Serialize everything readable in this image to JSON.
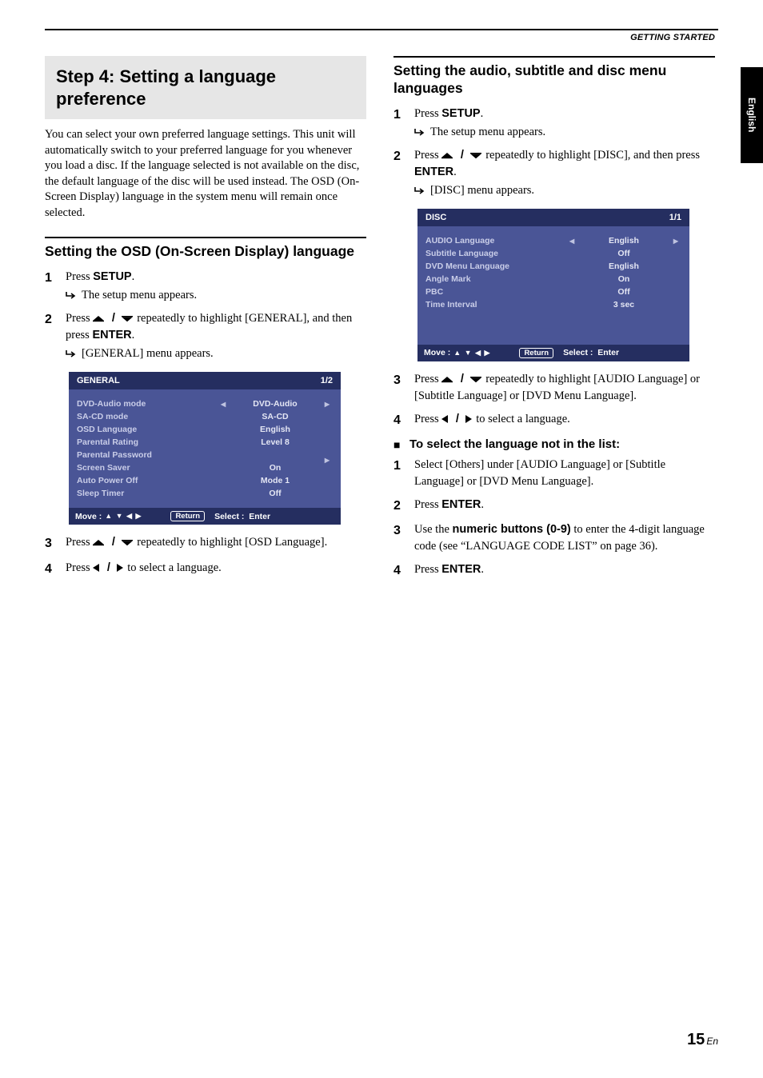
{
  "header_label": "GETTING STARTED",
  "side_tab": "English",
  "left": {
    "step_title": "Step 4: Setting a language preference",
    "intro": "You can select your own preferred language settings. This unit will automatically switch to your preferred language for you whenever you load a disc. If the language selected is not available on the disc, the default language of the disc will be used instead. The OSD (On-Screen Display) language in the system menu will remain once selected.",
    "heading1": "Setting the OSD (On-Screen Display) language",
    "s1": {
      "pre": "Press ",
      "btn": "SETUP",
      "post": ".",
      "sub": "The setup menu appears."
    },
    "s2": {
      "pre": "Press ",
      "mid1": " / ",
      "mid2": " repeatedly to highlight [GENERAL], and then press ",
      "btn": "ENTER",
      "post": ".",
      "sub": "[GENERAL] menu appears."
    },
    "menu": {
      "title": "GENERAL",
      "page": "1/2",
      "rows": [
        {
          "label": "DVD-Audio mode",
          "value": "DVD-Audio",
          "lr": true
        },
        {
          "label": "SA-CD mode",
          "value": "SA-CD"
        },
        {
          "label": "OSD Language",
          "value": "English"
        },
        {
          "label": "Parental Rating",
          "value": "Level 8"
        },
        {
          "label": "Parental Password",
          "value": "",
          "ronly": true
        },
        {
          "label": "Screen Saver",
          "value": "On"
        },
        {
          "label": "Auto Power Off",
          "value": "Mode 1"
        },
        {
          "label": "Sleep Timer",
          "value": "Off"
        }
      ],
      "footer": {
        "move": "Move :",
        "ret": "Return",
        "select": "Select :",
        "enter": "Enter"
      }
    },
    "s3": {
      "pre": "Press ",
      "mid1": " / ",
      "mid2": " repeatedly to highlight [OSD Language]."
    },
    "s4": {
      "pre": "Press ",
      "mid1": " / ",
      "mid2": " to select a language."
    }
  },
  "right": {
    "heading1": "Setting the audio, subtitle and disc menu languages",
    "s1": {
      "pre": "Press ",
      "btn": "SETUP",
      "post": ".",
      "sub": "The setup menu appears."
    },
    "s2": {
      "pre": "Press ",
      "mid1": " / ",
      "mid2": " repeatedly to highlight [DISC], and then press ",
      "btn": "ENTER",
      "post": ".",
      "sub": "[DISC] menu appears."
    },
    "menu": {
      "title": "DISC",
      "page": "1/1",
      "rows": [
        {
          "label": "AUDIO Language",
          "value": "English",
          "lr": true
        },
        {
          "label": "Subtitle Language",
          "value": "Off"
        },
        {
          "label": "DVD Menu Language",
          "value": "English"
        },
        {
          "label": "Angle Mark",
          "value": "On"
        },
        {
          "label": "PBC",
          "value": "Off"
        },
        {
          "label": "Time Interval",
          "value": "3 sec"
        }
      ],
      "footer": {
        "move": "Move :",
        "ret": "Return",
        "select": "Select :",
        "enter": "Enter"
      }
    },
    "s3": {
      "pre": "Press ",
      "mid1": " / ",
      "mid2": " repeatedly to highlight [AUDIO Language] or [Subtitle Language] or [DVD Menu Language]."
    },
    "s4": {
      "pre": "Press ",
      "mid1": " / ",
      "mid2": " to select a language."
    },
    "notinlist_heading": "To select the language not in the list:",
    "n1": "Select [Others] under [AUDIO Language] or [Subtitle Language] or [DVD Menu Language].",
    "n2": {
      "pre": "Press ",
      "btn": "ENTER",
      "post": "."
    },
    "n3": {
      "pre": "Use the ",
      "bold": "numeric buttons (0-9)",
      "post": " to enter the 4-digit language code (see “LANGUAGE CODE LIST” on page 36)."
    },
    "n4": {
      "pre": "Press ",
      "btn": "ENTER",
      "post": "."
    }
  },
  "page_num": "15",
  "page_suffix": "En"
}
